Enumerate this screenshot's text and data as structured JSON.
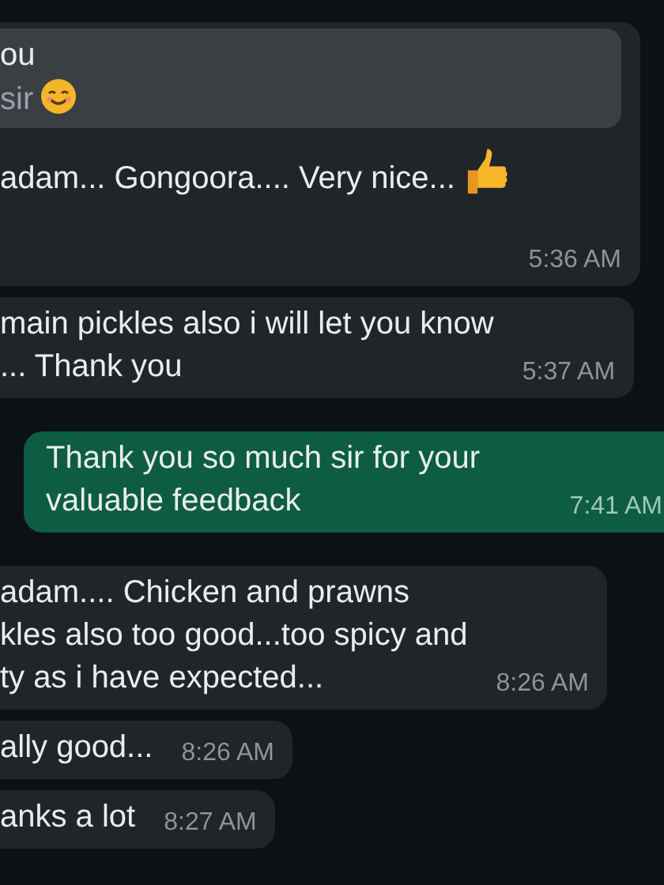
{
  "messages": [
    {
      "sent": false,
      "quote": {
        "author": "ou",
        "text": "sir",
        "kind": "smiley"
      },
      "lines": [
        {
          "text": "adam... Gongoora.... Very nice...",
          "kind": "thumbsup"
        }
      ],
      "time": "5:36 AM"
    },
    {
      "sent": false,
      "lines": [
        {
          "text": "main pickles also i will let you know",
          "kind": "plain"
        },
        {
          "text": "... Thank you",
          "kind": "plain"
        }
      ],
      "time": "5:37 AM"
    },
    {
      "sent": true,
      "lines": [
        {
          "text": "Thank you so much sir for your",
          "kind": "plain"
        },
        {
          "text": "valuable feedback",
          "kind": "plain"
        }
      ],
      "time": "7:41 AM"
    },
    {
      "sent": false,
      "lines": [
        {
          "text": "adam.... Chicken  and prawns",
          "kind": "plain"
        },
        {
          "text": "kles also too good...too spicy and",
          "kind": "plain"
        },
        {
          "text": "ty as i have expected...",
          "kind": "plain"
        }
      ],
      "time": "8:26 AM"
    },
    {
      "sent": false,
      "lines": [
        {
          "text": "ally good...",
          "kind": "plain"
        }
      ],
      "time": "8:26 AM"
    },
    {
      "sent": false,
      "lines": [
        {
          "text": "anks a lot",
          "kind": "plain"
        }
      ],
      "time": "8:27 AM"
    }
  ]
}
